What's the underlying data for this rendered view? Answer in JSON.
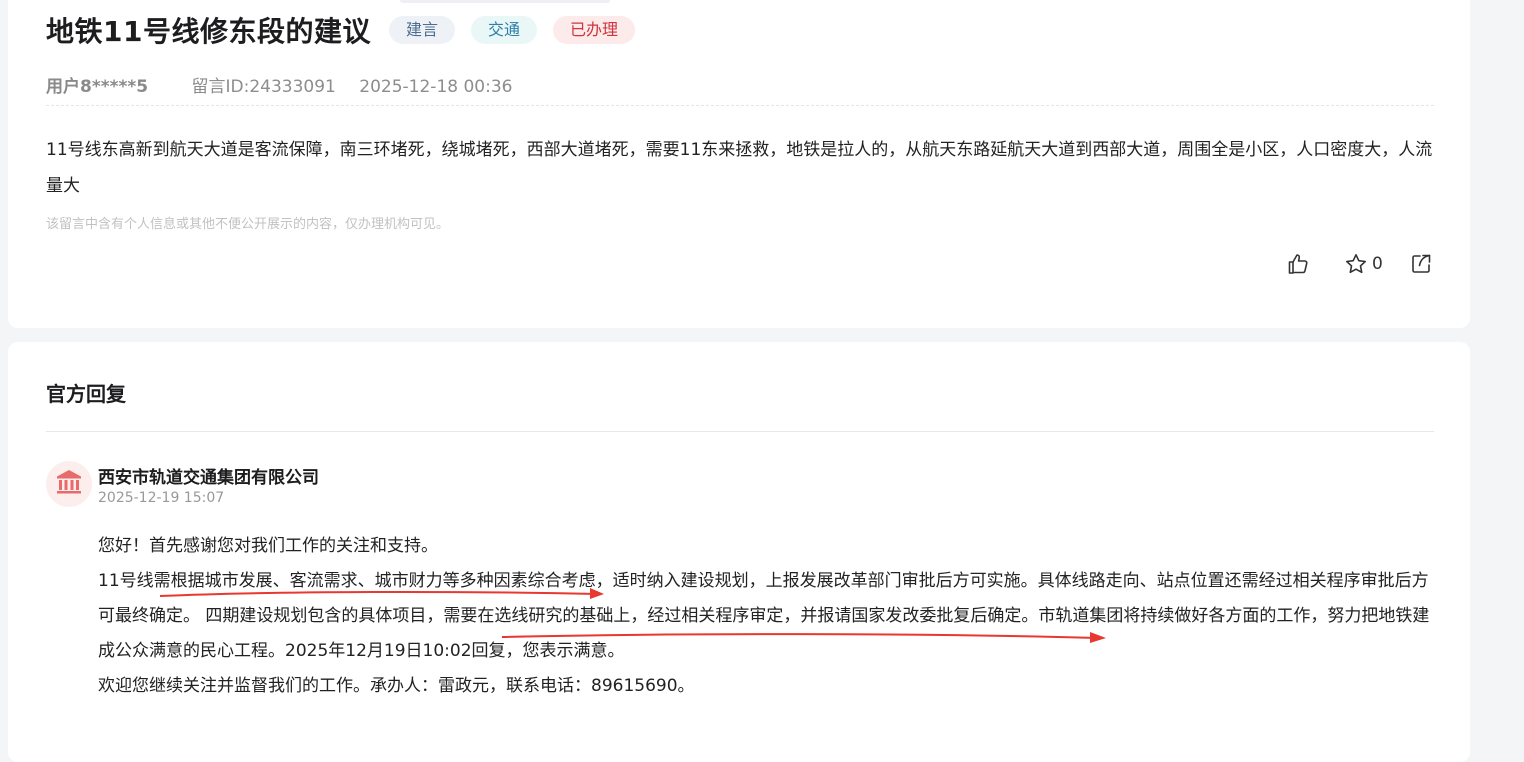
{
  "message": {
    "title": "地铁11号线修东段的建议",
    "tags": [
      "建言",
      "交通",
      "已办理"
    ],
    "user": "用户8*****5",
    "message_id": "留言ID:24333091",
    "time": "2025-12-18 00:36",
    "content": "11号线东高新到航天大道是客流保障，南三环堵死，绕城堵死，西部大道堵死，需要11东来拯救，地铁是拉人的，从航天东路延航天大道到西部大道，周围全是小区，人口密度大，人流量大",
    "privacy_notice": "该留言中含有个人信息或其他不便公开展示的内容，仅办理机构可见。",
    "favorite_count": "0"
  },
  "reply": {
    "heading": "官方回复",
    "org_name": "西安市轨道交通集团有限公司",
    "org_time": "2025-12-19 15:07",
    "paragraphs": [
      "您好！首先感谢您对我们工作的关注和支持。",
      "11号线需根据城市发展、客流需求、城市财力等多种因素综合考虑，适时纳入建设规划，上报发展改革部门审批后方可实施。具体线路走向、站点位置还需经过相关程序审批后方可最终确定。 四期建设规划包含的具体项目，需要在选线研究的基础上，经过相关程序审定，并报请国家发改委批复后确定。市轨道集团将持续做好各方面的工作，努力把地铁建成公众满意的民心工程。2025年12月19日10:02回复，您表示满意。",
      "欢迎您继续关注并监督我们的工作。承办人：雷政元，联系电话：89615690。"
    ]
  },
  "icons": {
    "like": "thumbs-up-icon",
    "favorite": "star-icon",
    "share": "share-icon",
    "org": "government-building-icon"
  },
  "colors": {
    "tag_done_text": "#d0343d",
    "annotation": "#e8382f"
  }
}
